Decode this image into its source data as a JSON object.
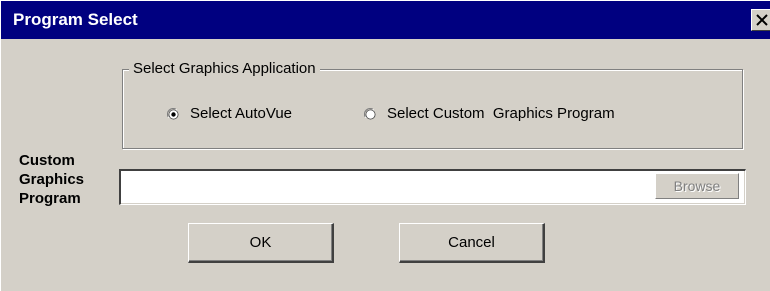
{
  "window": {
    "title": "Program Select",
    "close_symbol": "×",
    "colors": {
      "titlebar": "#000080",
      "face": "#d4d0c8"
    }
  },
  "group": {
    "legend": "Select Graphics Application",
    "options": [
      {
        "label": "Select AutoVue",
        "selected": true
      },
      {
        "label": "Select Custom  Graphics Program",
        "selected": false
      }
    ]
  },
  "custom_program": {
    "label_lines": [
      "Custom",
      "Graphics",
      "Program"
    ],
    "value": "",
    "browse_label": "Browse",
    "browse_enabled": false
  },
  "buttons": {
    "ok_label": "OK",
    "cancel_label": "Cancel"
  },
  "icons": {
    "close": "close-icon",
    "radio_on": "radio-selected-icon",
    "radio_off": "radio-unselected-icon"
  }
}
